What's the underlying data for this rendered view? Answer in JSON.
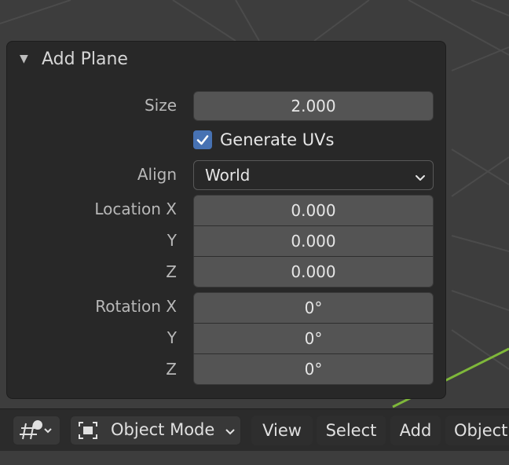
{
  "operator_panel": {
    "title": "Add Plane",
    "size_label": "Size",
    "size_value": "2.000",
    "generate_uvs_label": "Generate UVs",
    "generate_uvs_checked": true,
    "align_label": "Align",
    "align_value": "World",
    "location_label": "Location X",
    "location": {
      "x": "0.000",
      "y": "0.000",
      "z": "0.000"
    },
    "rotation_label": "Rotation X",
    "rotation": {
      "x": "0°",
      "y": "0°",
      "z": "0°"
    },
    "y_label": "Y",
    "z_label": "Z"
  },
  "header": {
    "mode_label": "Object Mode",
    "menus": [
      "View",
      "Select",
      "Add",
      "Object"
    ]
  },
  "icons": {
    "panel_collapse": "triangle-down-icon",
    "checkbox": "checkmark-icon",
    "align_dropdown": "chevron-down-icon",
    "editor_type": "3d-viewport-icon",
    "object_mode": "object-mode-icon"
  },
  "colors": {
    "viewport_bg": "#3d3d3d",
    "panel_bg": "#282828",
    "field_bg": "#545454",
    "checkbox_accent": "#4772b3",
    "grid_line": "#4a4a4a",
    "axis_x": "#7fb83a",
    "axis_z": "#3a72c8"
  }
}
